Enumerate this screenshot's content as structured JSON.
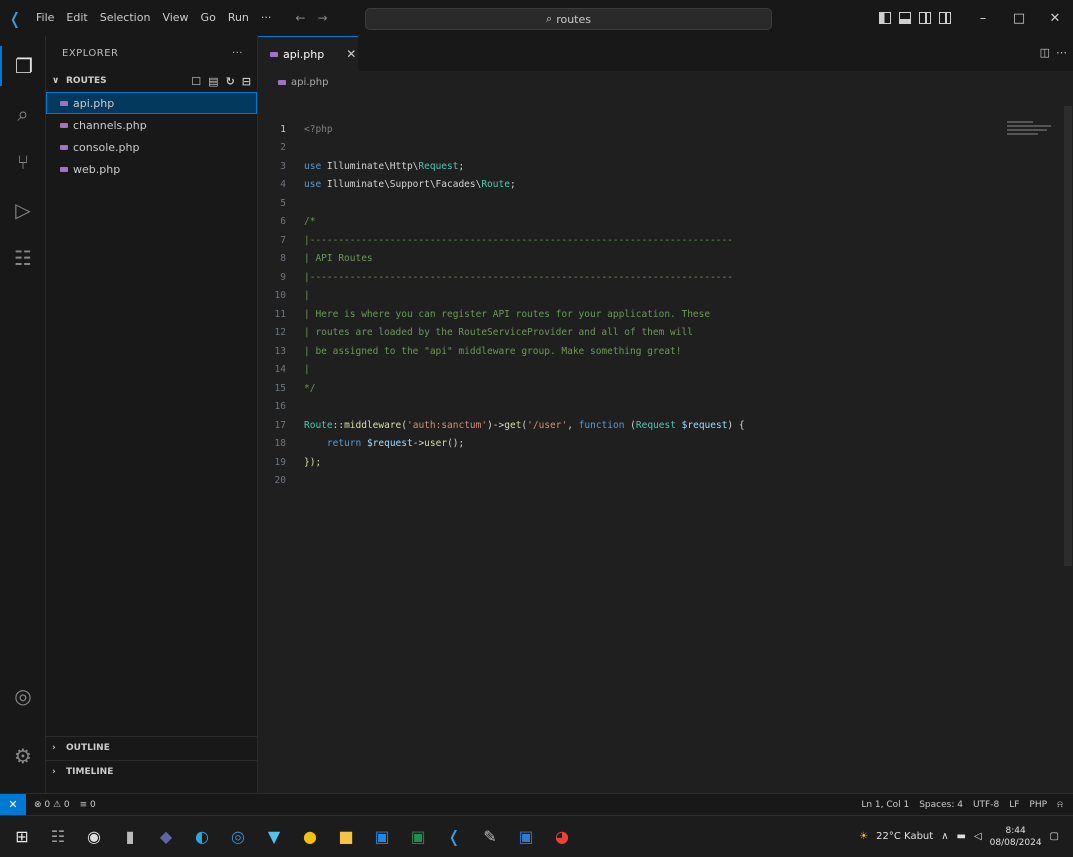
{
  "titlebar": {
    "menu": [
      "File",
      "Edit",
      "Selection",
      "View",
      "Go",
      "Run",
      "···"
    ],
    "search_text": "routes"
  },
  "activity_bar": {
    "icons": [
      "explorer-icon",
      "search-icon",
      "source-control-icon",
      "run-debug-icon",
      "extensions-icon",
      "account-icon",
      "settings-gear-icon"
    ]
  },
  "sidebar": {
    "title": "EXPLORER",
    "more": "···",
    "folder": "ROUTES",
    "files": [
      "api.php",
      "channels.php",
      "console.php",
      "web.php"
    ],
    "outline": "OUTLINE",
    "timeline": "TIMELINE"
  },
  "editor": {
    "tab_label": "api.php",
    "breadcrumb": "api.php",
    "lines": [
      {
        "n": "1"
      },
      {
        "n": "2"
      },
      {
        "n": "3"
      },
      {
        "n": "4"
      },
      {
        "n": "5"
      },
      {
        "n": "6"
      },
      {
        "n": "7"
      },
      {
        "n": "8"
      },
      {
        "n": "9"
      },
      {
        "n": "10"
      },
      {
        "n": "11"
      },
      {
        "n": "12"
      },
      {
        "n": "13"
      },
      {
        "n": "14"
      },
      {
        "n": "15"
      },
      {
        "n": "16"
      },
      {
        "n": "17"
      },
      {
        "n": "18"
      },
      {
        "n": "19"
      },
      {
        "n": "20"
      }
    ],
    "code": {
      "l1": "<?php",
      "l3_use": "use",
      "l3_ns": " Illuminate\\Http\\",
      "l3_cls": "Request",
      "l3_end": ";",
      "l4_use": "use",
      "l4_ns": " Illuminate\\Support\\Facades\\",
      "l4_cls": "Route",
      "l4_end": ";",
      "l6": "/*",
      "l7": "|--------------------------------------------------------------------------",
      "l8": "| API Routes",
      "l9": "|--------------------------------------------------------------------------",
      "l10": "|",
      "l11": "| Here is where you can register API routes for your application. These",
      "l12": "| routes are loaded by the RouteServiceProvider and all of them will",
      "l13": "| be assigned to the \"api\" middleware group. Make something great!",
      "l14": "|",
      "l15": "*/",
      "l17_route": "Route",
      "l17_sep": "::",
      "l17_mw": "middleware",
      "l17_p1": "(",
      "l17_s1": "'auth:sanctum'",
      "l17_p2": ")->",
      "l17_get": "get",
      "l17_p3": "(",
      "l17_s2": "'/user'",
      "l17_p4": ", ",
      "l17_fn": "function",
      "l17_p5": " (",
      "l17_req": "Request",
      "l17_sp": " ",
      "l17_var": "$request",
      "l17_p6": ") {",
      "l18_indent": "    ",
      "l18_ret": "return",
      "l18_sp": " ",
      "l18_var": "$request",
      "l18_arrow": "->",
      "l18_user": "user",
      "l18_end": "();",
      "l19": "});"
    }
  },
  "statusbar": {
    "remote": "✕",
    "problems": "⊗ 0 ⚠ 0",
    "ports": "≡ 0",
    "position": "Ln 1, Col 1",
    "spaces": "Spaces: 4",
    "encoding": "UTF-8",
    "eol": "LF",
    "language": "PHP"
  },
  "taskbar": {
    "weather": "22°C Kabut",
    "time": "8:44",
    "date": "08/08/2024"
  }
}
